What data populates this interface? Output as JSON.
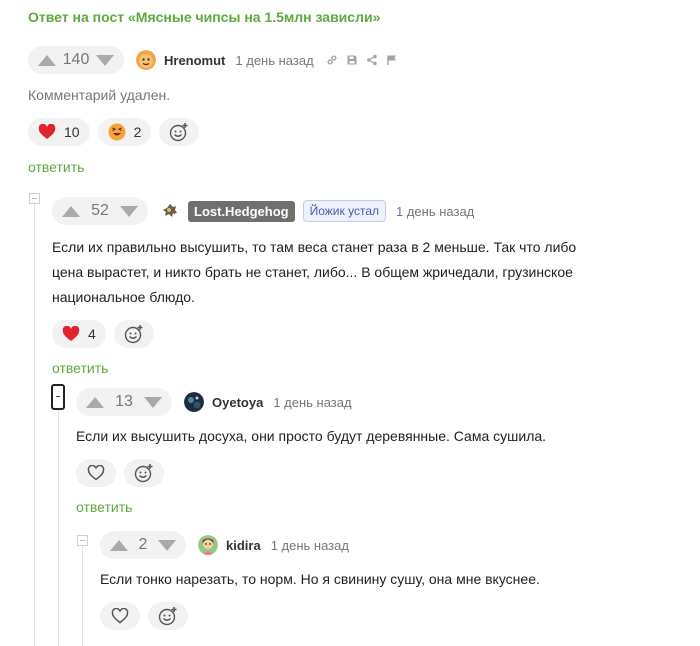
{
  "post": {
    "reply_title": "Ответ на пост «Мясные чипсы на 1.5млн зависли»"
  },
  "comments": [
    {
      "votes": "140",
      "username": "Hrenomut",
      "time": "1 день назад",
      "text": "Комментарий удален.",
      "reactions": [
        {
          "icon": "heart-icon",
          "count": "10"
        },
        {
          "icon": "laughing-emoji-icon",
          "count": "2"
        }
      ],
      "reply_label": "ответить"
    },
    {
      "votes": "52",
      "username": "Lost.Hedgehog",
      "tag": "Йожик устал",
      "time": "1 день назад",
      "text": "Если их правильно высушить, то там веса станет раза в 2 меньше. Так что либо цена вырастет, и никто брать не станет, либо... В общем жричедали, грузинское национальное блюдо.",
      "reactions": [
        {
          "icon": "heart-icon",
          "count": "4"
        }
      ],
      "reply_label": "ответить"
    },
    {
      "votes": "13",
      "username": "Oyetoya",
      "time": "1 день назад",
      "text": "Если их высушить досуха, они просто будут деревянные. Сама сушила.",
      "reply_label": "ответить"
    },
    {
      "votes": "2",
      "username": "kidira",
      "time": "1 день назад",
      "text": "Если тонко нарезать, то норм. Но я свинину сушу, она мне вкуснее."
    }
  ],
  "colors": {
    "accent_green": "#5fa840",
    "heart_red": "#e0252e",
    "tag_blue": "#4a5bab"
  }
}
